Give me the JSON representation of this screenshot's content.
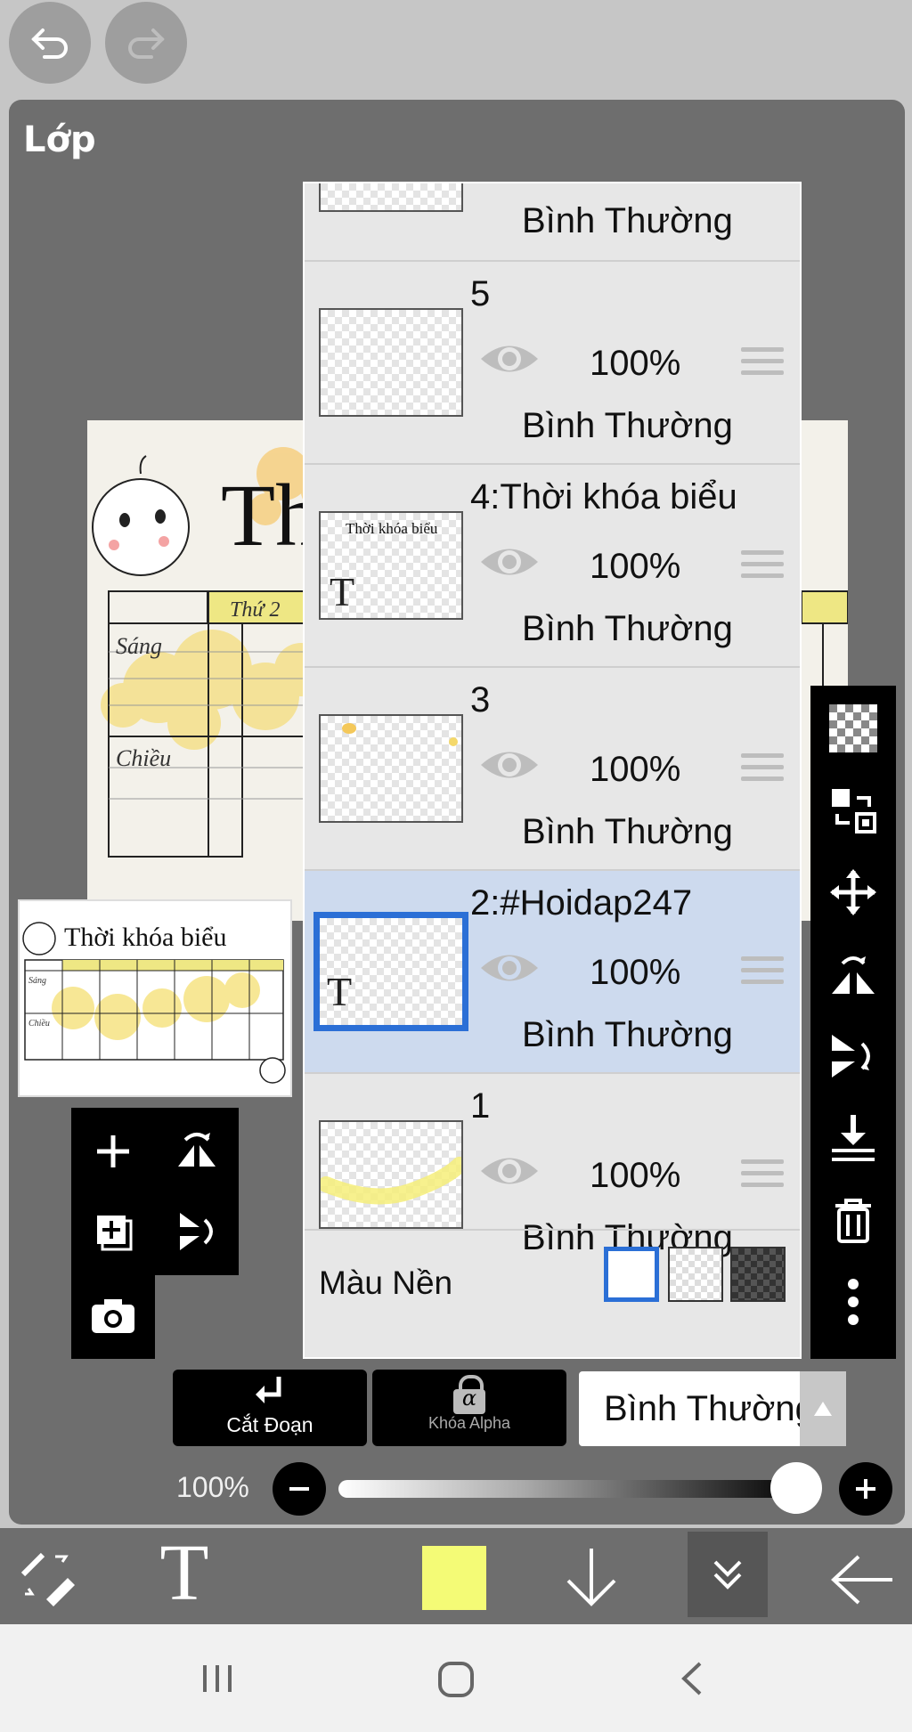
{
  "top": {
    "undo_icon": "undo-icon",
    "redo_icon": "redo-icon"
  },
  "panel": {
    "title": "Lớp"
  },
  "artwork": {
    "title_partial": "Th",
    "col_header": "Thứ 2",
    "row_morning": "Sáng",
    "row_afternoon": "Chiều"
  },
  "preview": {
    "title": "Thời khóa biểu",
    "row_morning": "Sáng",
    "row_afternoon": "Chiều"
  },
  "layers": [
    {
      "name": "",
      "opacity": "",
      "blend": "Bình Thường",
      "selected": false,
      "partial": true
    },
    {
      "name": "5",
      "opacity": "100%",
      "blend": "Bình Thường",
      "selected": false
    },
    {
      "name": "4:Thời khóa biểu",
      "opacity": "100%",
      "blend": "Bình Thường",
      "selected": false,
      "thumb_text": "Thời khóa biểu",
      "thumb_glyph": "T"
    },
    {
      "name": "3",
      "opacity": "100%",
      "blend": "Bình Thường",
      "selected": false
    },
    {
      "name": "2:#Hoidap247",
      "opacity": "100%",
      "blend": "Bình Thường",
      "selected": true,
      "thumb_glyph": "T"
    },
    {
      "name": "1",
      "opacity": "100%",
      "blend": "Bình Thường",
      "selected": false
    }
  ],
  "background": {
    "label": "Màu Nền",
    "selected_swatch": "white"
  },
  "sidebar_tools": [
    "checkerboard-icon",
    "transform-swap-icon",
    "move-icon",
    "flip-horizontal-icon",
    "flip-vertical-icon",
    "merge-down-icon",
    "delete-icon",
    "more-icon"
  ],
  "controls": {
    "clip_label": "Cắt Đoạn",
    "alpha_lock_label": "Khóa Alpha",
    "alpha_glyph": "α",
    "blend_mode": "Bình Thường",
    "opacity_label": "100%",
    "opacity_value": 1.0
  },
  "bottom": {
    "text_tool_glyph": "T",
    "color": "#f4fb76"
  },
  "colors": {
    "selection": "#2b6fd6",
    "selected_row": "#cddaee"
  }
}
